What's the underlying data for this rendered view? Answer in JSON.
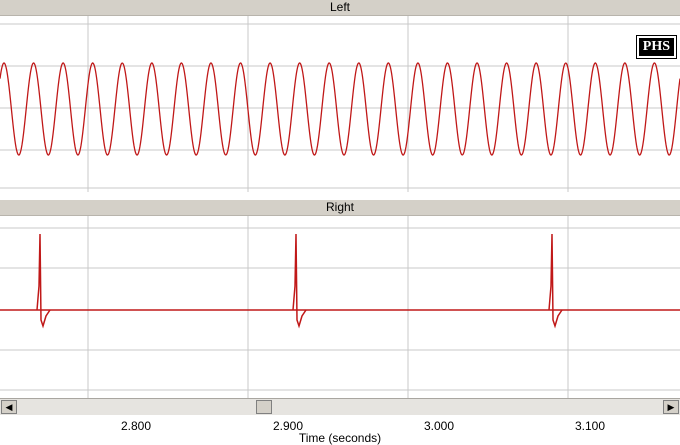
{
  "channels": {
    "left": {
      "title": "Left"
    },
    "right": {
      "title": "Right"
    }
  },
  "badge": "PHS",
  "waveform_color": "#c01818",
  "grid_color": "#c8c8c8",
  "scrollbar": {
    "left_arrow": "◀",
    "right_arrow": "▶"
  },
  "time_axis": {
    "title": "Time (seconds)",
    "ticks": [
      "2.800",
      "2.900",
      "3.000",
      "3.100"
    ]
  },
  "chart_data": {
    "type": "line",
    "xlabel": "Time (seconds)",
    "xlim": [
      2.745,
      3.17
    ],
    "x_ticks": [
      2.8,
      2.9,
      3.0,
      3.1
    ],
    "grid": true,
    "series": [
      {
        "name": "Left",
        "waveform": "sine",
        "cycles_visible": 23
      },
      {
        "name": "Right",
        "waveform": "periodic spikes",
        "spike_times": [
          2.77,
          2.93,
          3.09
        ]
      }
    ]
  }
}
